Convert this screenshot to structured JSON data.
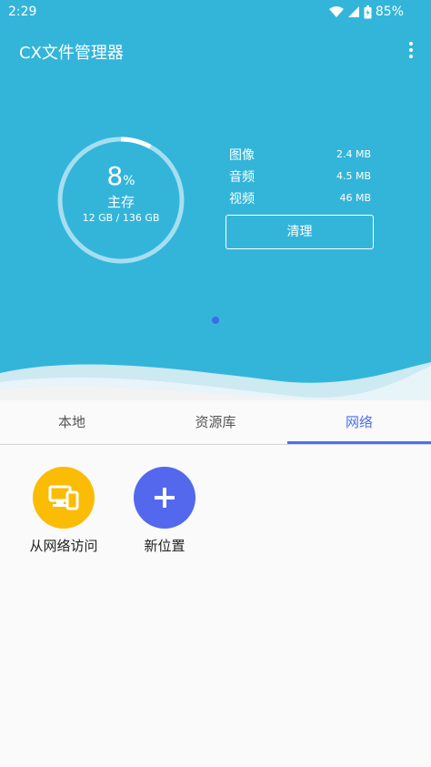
{
  "status_bar": {
    "time": "2:29",
    "battery": "85%"
  },
  "app": {
    "title": "CX文件管理器"
  },
  "storage": {
    "percent": "8",
    "percent_unit": "%",
    "percent_value": 8,
    "label": "主存",
    "size": "12 GB / 136 GB"
  },
  "stats": [
    {
      "label": "图像",
      "value": "2.4 MB"
    },
    {
      "label": "音频",
      "value": "4.5 MB"
    },
    {
      "label": "视频",
      "value": "46 MB"
    }
  ],
  "clean_label": "清理",
  "tabs": [
    {
      "label": "本地"
    },
    {
      "label": "资源库"
    },
    {
      "label": "网络"
    }
  ],
  "active_tab": "网络",
  "network_items": [
    {
      "label": "从网络访问",
      "icon": "devices-icon",
      "color": "#fbbc05"
    },
    {
      "label": "新位置",
      "icon": "plus-icon",
      "color": "#5468ee"
    }
  ],
  "colors": {
    "header": "#33b5da",
    "accent": "#4d6ff2",
    "page_dot": "#3f6ae8",
    "background": "#fafafa"
  }
}
